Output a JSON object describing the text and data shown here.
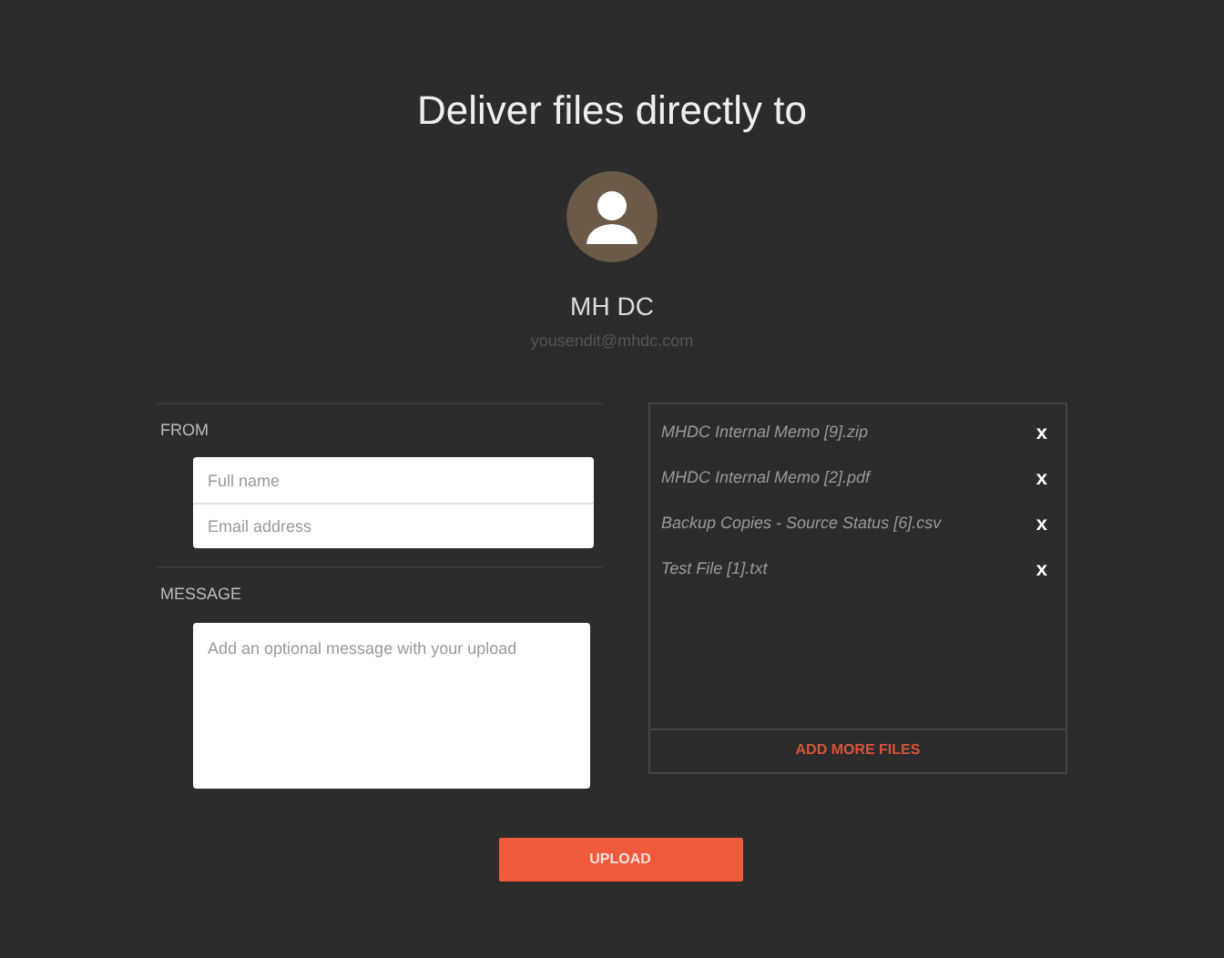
{
  "title": "Deliver files directly to",
  "recipient": {
    "name": "MH DC",
    "email": "yousendit@mhdc.com"
  },
  "from": {
    "label": "FROM",
    "fields": [
      {
        "placeholder": "Full name"
      },
      {
        "placeholder": "Email address"
      }
    ]
  },
  "message": {
    "label": "MESSAGE",
    "placeholder": "Add an optional message with your upload"
  },
  "files": [
    {
      "name": "MHDC Internal Memo [9].zip",
      "remove": "x"
    },
    {
      "name": "MHDC Internal Memo [2].pdf",
      "remove": "x"
    },
    {
      "name": "Backup Copies - Source Status [6].csv",
      "remove": "x"
    },
    {
      "name": "Test File [1].txt",
      "remove": "x"
    }
  ],
  "add_more": "ADD MORE FILES",
  "upload": "UPLOAD"
}
